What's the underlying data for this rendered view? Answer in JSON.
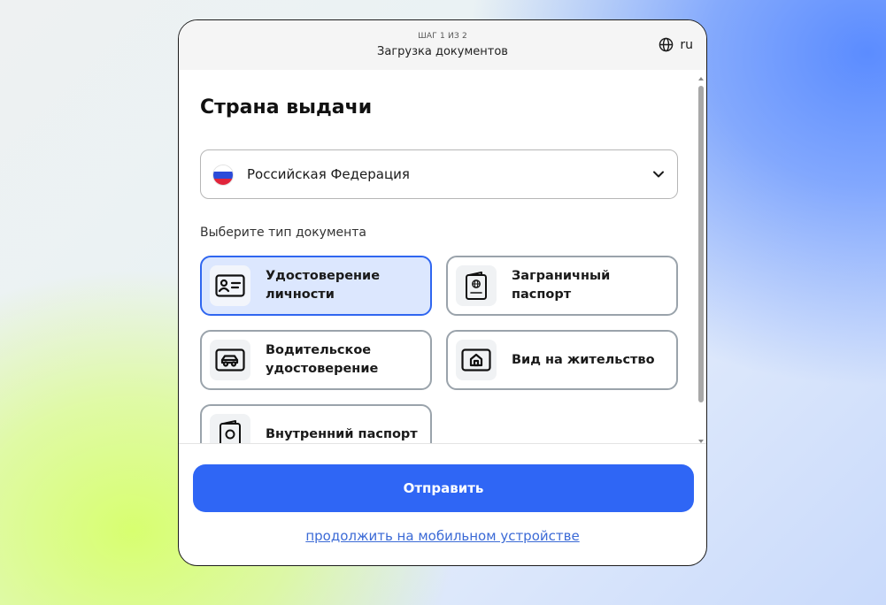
{
  "header": {
    "step": "ШАГ 1 ИЗ 2",
    "title": "Загрузка документов",
    "language": "ru"
  },
  "form": {
    "section_title": "Страна выдачи",
    "country": "Российская Федерация",
    "doc_type_label": "Выберите тип документа",
    "documents": [
      {
        "label": "Удостоверение личности",
        "icon": "id-card-icon",
        "selected": true
      },
      {
        "label": "Заграничный паспорт",
        "icon": "passport-icon",
        "selected": false
      },
      {
        "label": "Водительское удостоверение",
        "icon": "car-icon",
        "selected": false
      },
      {
        "label": "Вид на жительство",
        "icon": "home-icon",
        "selected": false
      },
      {
        "label": "Внутренний паспорт",
        "icon": "internal-passport-icon",
        "selected": false
      }
    ]
  },
  "footer": {
    "submit_label": "Отправить",
    "mobile_link": "продолжить на мобильном устройстве"
  },
  "colors": {
    "accent": "#2f66f5",
    "selected_bg": "#dce7fe",
    "link": "#3b6ad6"
  }
}
